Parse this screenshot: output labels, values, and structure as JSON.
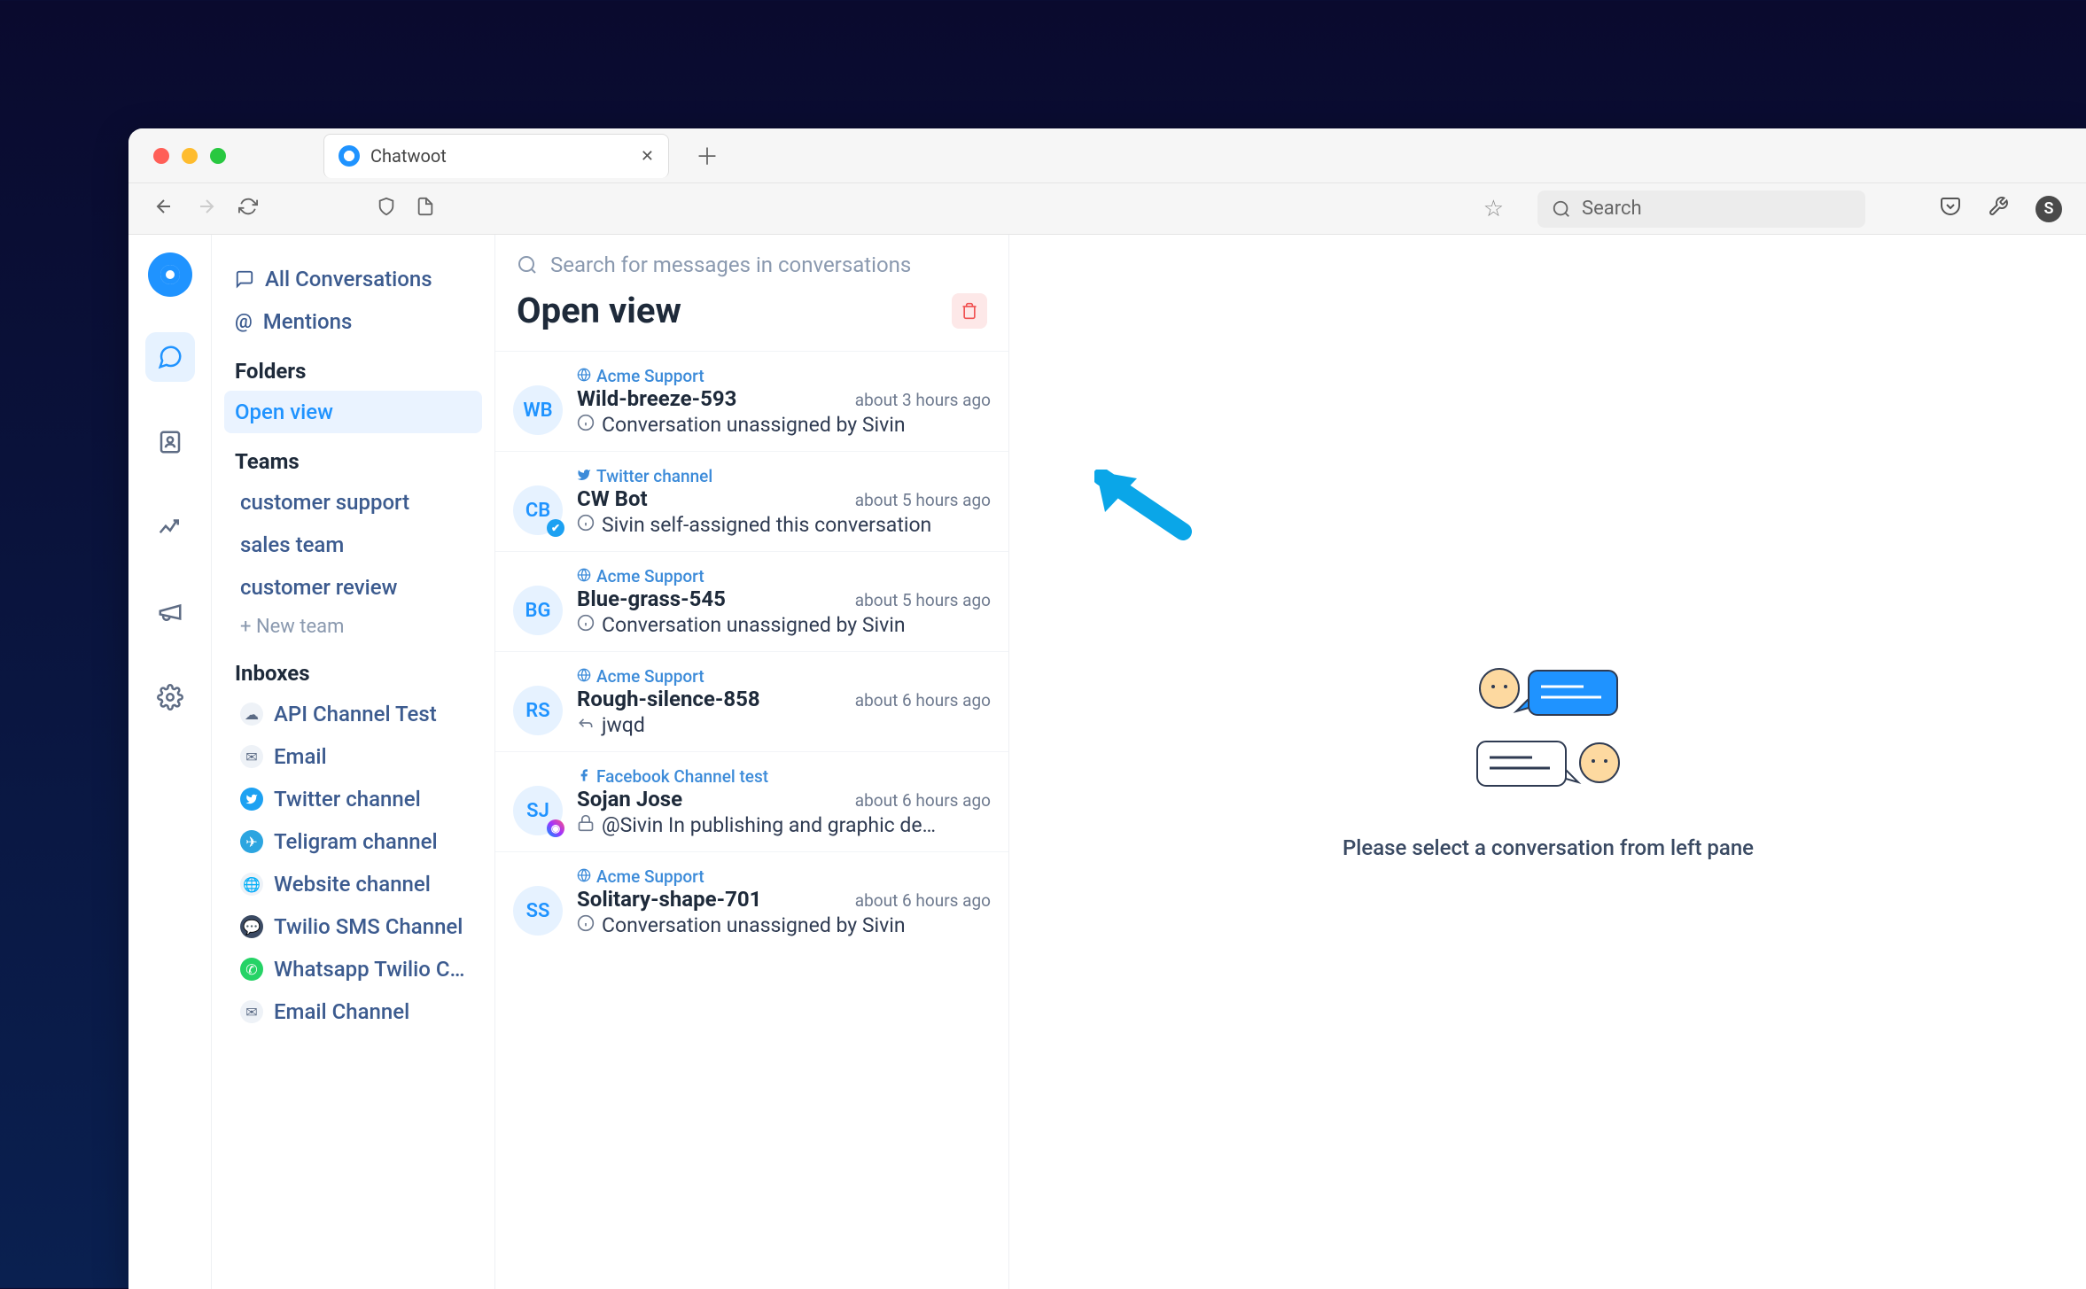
{
  "browser": {
    "tab_title": "Chatwoot",
    "search_placeholder": "Search",
    "profile_initial": "S"
  },
  "sidebar": {
    "all_conversations": "All Conversations",
    "mentions": "Mentions",
    "folders_label": "Folders",
    "folders": [
      {
        "label": "Open view",
        "active": true
      }
    ],
    "teams_label": "Teams",
    "teams": [
      {
        "label": "customer support"
      },
      {
        "label": "sales team"
      },
      {
        "label": "customer review"
      }
    ],
    "new_team": "+ New team",
    "inboxes_label": "Inboxes",
    "inboxes": [
      {
        "label": "API Channel Test",
        "icon": "cloud"
      },
      {
        "label": "Email",
        "icon": "mail"
      },
      {
        "label": "Twitter channel",
        "icon": "twitter"
      },
      {
        "label": "Teligram channel",
        "icon": "telegram"
      },
      {
        "label": "Website channel",
        "icon": "globe"
      },
      {
        "label": "Twilio SMS Channel",
        "icon": "chat"
      },
      {
        "label": "Whatsapp Twilio C…",
        "icon": "whatsapp"
      },
      {
        "label": "Email Channel",
        "icon": "mail"
      }
    ]
  },
  "conv": {
    "search_placeholder": "Search for messages in conversations",
    "title": "Open view",
    "items": [
      {
        "channel": "Acme Support",
        "channel_icon": "globe",
        "avatar": "WB",
        "name": "Wild-breeze-593",
        "time": "about 3 hours ago",
        "msg_icon": "info",
        "msg": "Conversation unassigned by Sivin"
      },
      {
        "channel": "Twitter channel",
        "channel_icon": "twitter",
        "avatar": "CB",
        "badge": "twitter",
        "name": "CW Bot",
        "time": "about 5 hours ago",
        "msg_icon": "info",
        "msg": "Sivin self-assigned this conversation"
      },
      {
        "channel": "Acme Support",
        "channel_icon": "globe",
        "avatar": "BG",
        "name": "Blue-grass-545",
        "time": "about 5 hours ago",
        "msg_icon": "info",
        "msg": "Conversation unassigned by Sivin"
      },
      {
        "channel": "Acme Support",
        "channel_icon": "globe",
        "avatar": "RS",
        "name": "Rough-silence-858",
        "time": "about 6 hours ago",
        "msg_icon": "reply",
        "msg": "jwqd"
      },
      {
        "channel": "Facebook Channel test",
        "channel_icon": "facebook",
        "avatar": "SJ",
        "badge": "messenger",
        "name": "Sojan Jose",
        "time": "about 6 hours ago",
        "msg_icon": "lock",
        "msg": "@Sivin In publishing and graphic de…"
      },
      {
        "channel": "Acme Support",
        "channel_icon": "globe",
        "avatar": "SS",
        "name": "Solitary-shape-701",
        "time": "about 6 hours ago",
        "msg_icon": "info",
        "msg": "Conversation unassigned by Sivin"
      }
    ]
  },
  "main": {
    "empty": "Please select a conversation from left pane"
  }
}
